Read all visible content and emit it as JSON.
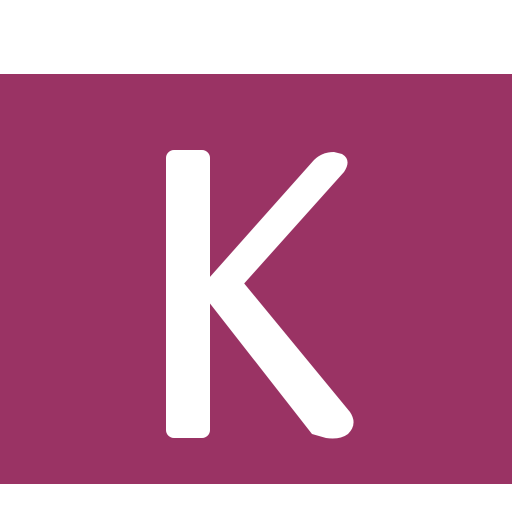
{
  "logo": {
    "letter": "K",
    "background_color": "#9a3364",
    "letter_color": "#ffffff",
    "page_color": "#ffffff"
  }
}
